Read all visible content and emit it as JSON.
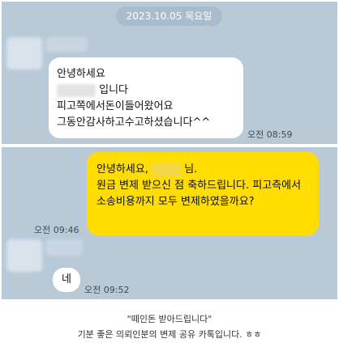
{
  "date_divider": "2023.10.05 목요일",
  "messages": {
    "m1": {
      "lines": [
        "안녕하세요",
        "입니다",
        "피고쪽에서돈이들어왔어요",
        "그동안감사하고수고하셨습니다^^"
      ],
      "time": "오전 08:59"
    },
    "m2": {
      "line1_prefix": "안녕하세요,",
      "line1_suffix": "님.",
      "body": "원금 변제 받으신 점 축하드립니다. 피고측에서 소송비용까지 모두 변제하였을까요?",
      "time": "오전 09:46"
    },
    "m3": {
      "text": "네",
      "time": "오전 09:52"
    }
  },
  "caption": {
    "line1": "\"떼인돈 받아드립니다\"",
    "line2": "기분 좋은 의뢰인분의 변제 공유 카톡입니다. ㅎㅎ"
  },
  "colors": {
    "chat_bg": "#b8c9d8",
    "sent_bubble": "#ffdd00",
    "recv_bubble": "#ffffff"
  }
}
